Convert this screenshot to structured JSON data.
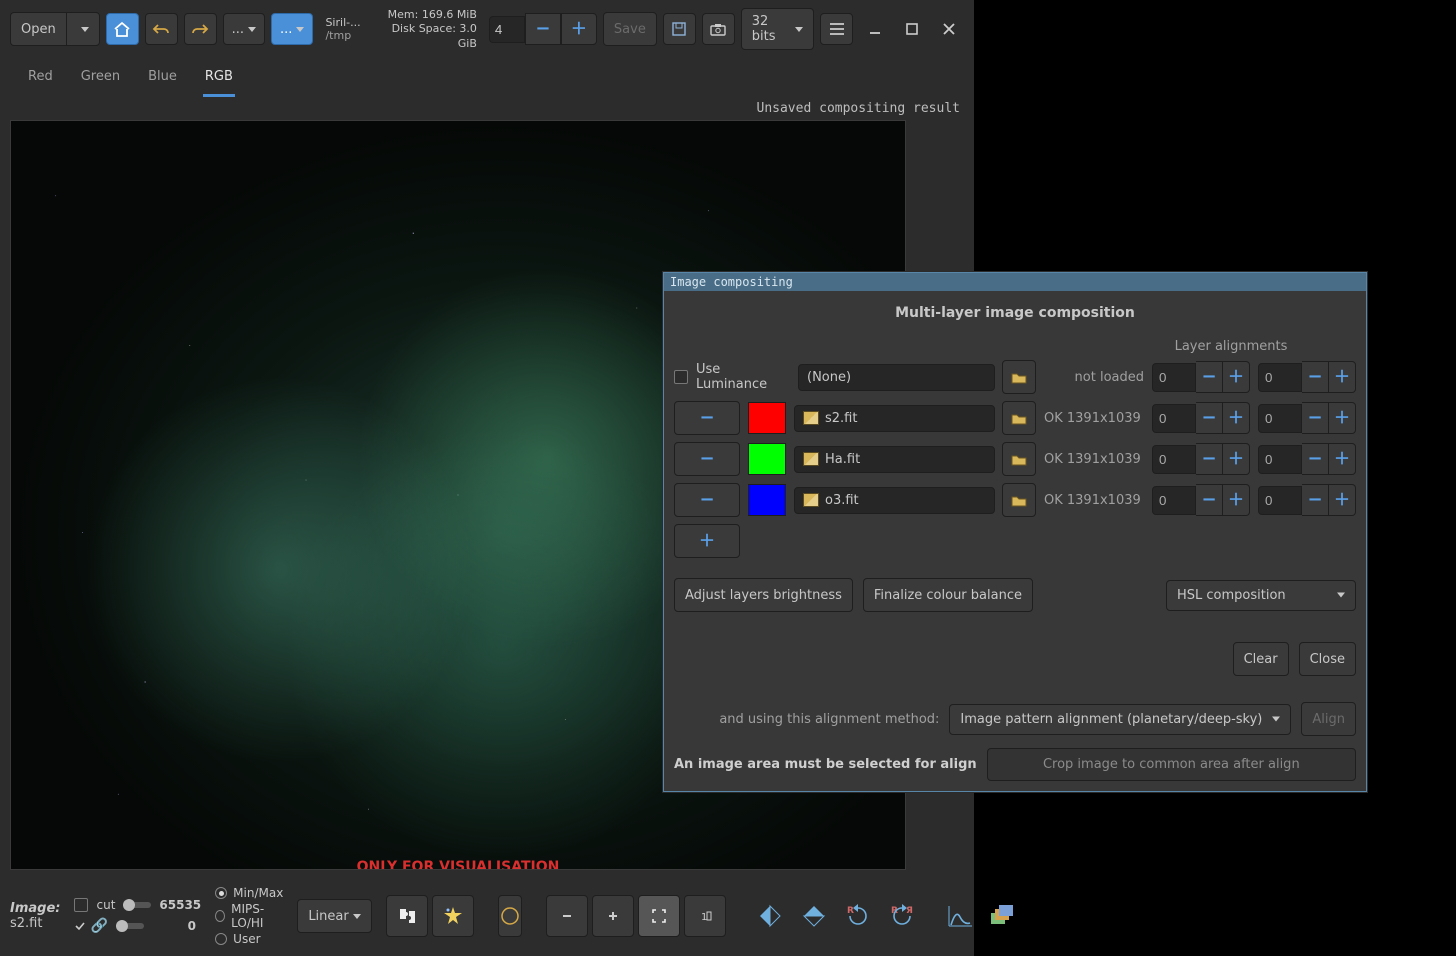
{
  "toolbar": {
    "open": "Open",
    "title": "Siril-...",
    "subtitle": "/tmp",
    "mem": "Mem: 169.6 MiB",
    "disk": "Disk Space: 3.0 GiB",
    "zoom_value": "4",
    "save": "Save",
    "bits": "32 bits",
    "dots": "..."
  },
  "tabs": {
    "red": "Red",
    "green": "Green",
    "blue": "Blue",
    "rgb": "RGB"
  },
  "status": "Unsaved compositing result",
  "vis_label": "ONLY FOR VISUALISATION",
  "bottom": {
    "image_label": "Image:",
    "image_name": "s2.fit",
    "cut": "cut",
    "hi": "65535",
    "lo": "0",
    "r1": "Min/Max",
    "r2": "MIPS-LO/HI",
    "r3": "User",
    "linear": "Linear"
  },
  "dialog": {
    "title": "Image compositing",
    "heading": "Multi-layer image composition",
    "layer_alignments": "Layer alignments",
    "use_lum": "Use Luminance",
    "none": "(None)",
    "not_loaded": "not loaded",
    "ok_dim": "OK 1391x1039",
    "f1": "s2.fit",
    "f2": "Ha.fit",
    "f3": "o3.fit",
    "zero": "0",
    "adjust": "Adjust layers brightness",
    "finalize": "Finalize colour balance",
    "hsl": "HSL composition",
    "clear": "Clear",
    "close": "Close",
    "align_method_label": "and using this alignment method:",
    "align_method": "Image pattern alignment (planetary/deep-sky)",
    "align": "Align",
    "warn": "An image area must be selected for align",
    "crop": "Crop image to common area after align"
  }
}
